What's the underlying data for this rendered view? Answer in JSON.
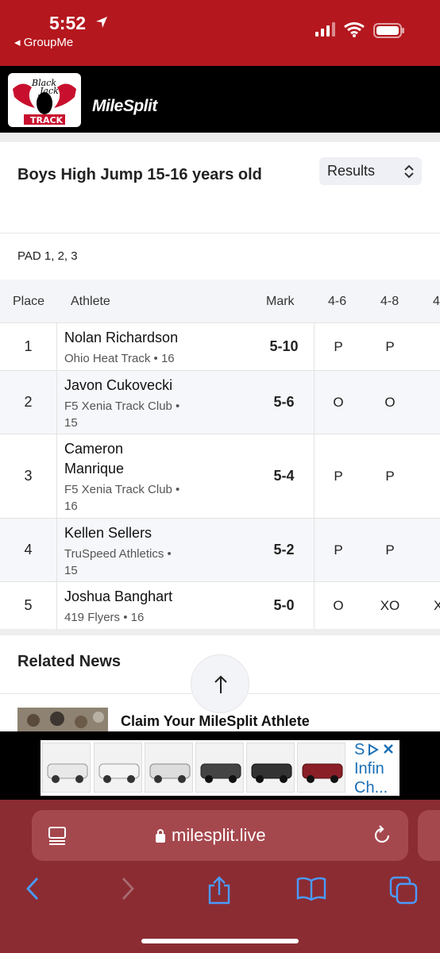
{
  "status_bar": {
    "time": "5:52",
    "back_app": "◂ GroupMe"
  },
  "header": {
    "brand": "MileSplit",
    "logo_text_1": "Black",
    "logo_text_2": "Jack",
    "logo_text_3": "TRACK"
  },
  "event": {
    "title": "Boys High Jump 15-16 years old",
    "view_select": "Results",
    "heights_label": "PAD 1, 2, 3"
  },
  "table": {
    "headers": {
      "place": "Place",
      "athlete": "Athlete",
      "mark": "Mark",
      "h1": "4-6",
      "h2": "4-8",
      "h3": "4"
    },
    "rows": [
      {
        "place": "1",
        "name": "Nolan Richardson",
        "team": "Ohio Heat Track • 16",
        "mark": "5-10",
        "a1": "P",
        "a2": "P",
        "a3": ""
      },
      {
        "place": "2",
        "name": "Javon Cukovecki",
        "team_1": "F5 Xenia Track Club •",
        "team_2": "15",
        "mark": "5-6",
        "a1": "O",
        "a2": "O",
        "a3": ""
      },
      {
        "place": "3",
        "name_1": "Cameron",
        "name_2": "Manrique",
        "team_1": "F5 Xenia Track Club •",
        "team_2": "16",
        "mark": "5-4",
        "a1": "P",
        "a2": "P",
        "a3": ""
      },
      {
        "place": "4",
        "name": "Kellen Sellers",
        "team_1": "TruSpeed Athletics •",
        "team_2": "15",
        "mark": "5-2",
        "a1": "P",
        "a2": "P",
        "a3": ""
      },
      {
        "place": "5",
        "name": "Joshua Banghart",
        "team": "419 Flyers • 16",
        "mark": "5-0",
        "a1": "O",
        "a2": "XO",
        "a3": "X"
      }
    ]
  },
  "news": {
    "section_title": "Related News",
    "headline": "Claim Your MileSplit Athlete"
  },
  "ad": {
    "text_1": "S",
    "text_2": "Infin",
    "text_3": "Ch..."
  },
  "browser": {
    "url": "milesplit.live"
  },
  "colors": {
    "status_red": "#b5171e",
    "safari_bar": "#8b2c32",
    "ad_blue": "#1b6fb5"
  }
}
